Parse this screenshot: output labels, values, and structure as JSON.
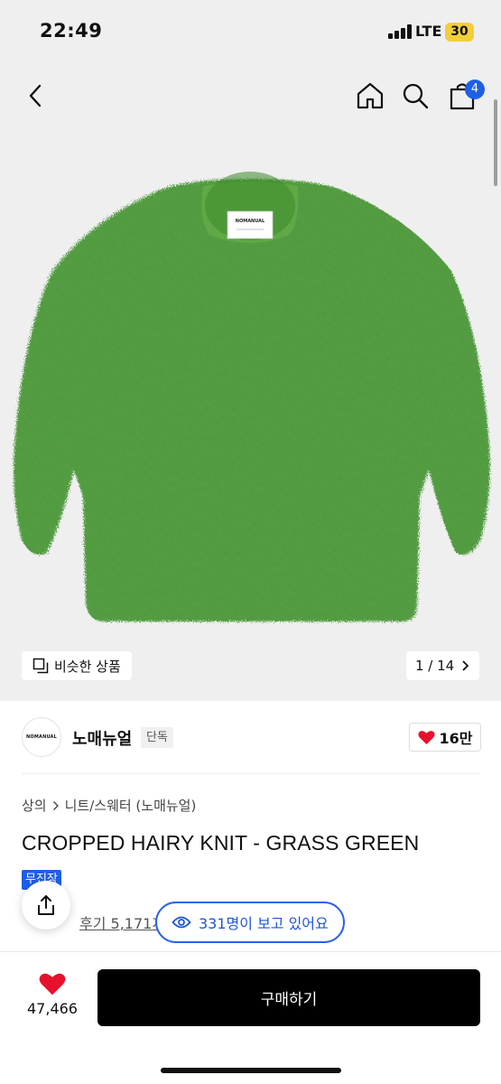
{
  "status_bar": {
    "time": "22:49",
    "network": "LTE",
    "battery": "30"
  },
  "nav": {
    "cart_count": "4"
  },
  "gallery": {
    "similar_label": "비슷한 상품",
    "page_counter": "1 / 14",
    "product_tag_text": "NOMANUAL"
  },
  "brand": {
    "logo_text": "NOMANUAL",
    "name": "노매뉴얼",
    "badge": "단독",
    "likes": "16만"
  },
  "breadcrumb": {
    "category": "상의",
    "subcategory": "니트/스웨터 (노매뉴얼)"
  },
  "product": {
    "title": "CROPPED HAIRY KNIT - GRASS GREEN",
    "shipping_tag": "무진장"
  },
  "reviews": {
    "label": "후기 5,171개"
  },
  "viewers": {
    "text": "331명이 보고 있어요"
  },
  "bottom": {
    "wish_count": "47,466",
    "buy_label": "구매하기"
  },
  "colors": {
    "accent_blue": "#1e5fe6",
    "like_red": "#e8112d",
    "sweater_green": "#4a9a36"
  }
}
